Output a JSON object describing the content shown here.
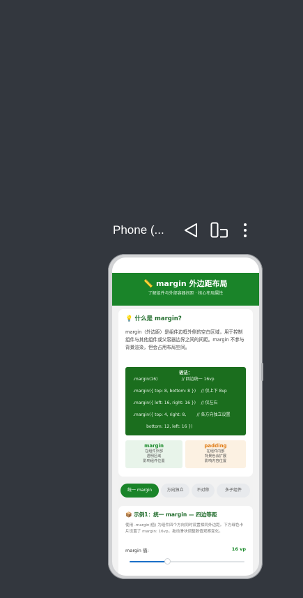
{
  "device": {
    "name": "Phone (...",
    "back_icon": "back-triangle-icon",
    "rotate_icon": "rotate-device-icon",
    "more_icon": "more-vertical-icon"
  },
  "header": {
    "title": "📏 margin 外边距布局",
    "subtitle": "了解组件与外部容器间距 · 核心布局属性"
  },
  "intro": {
    "heading": "💡 什么是 margin?",
    "description": "margin（外边距）是组件边框外侧的空白区域，用于控制组件与其他组件或父容器边界之间的间距。margin 不参与背景渲染，但会占用布局空间。",
    "code_title": "语法：",
    "code_lines": [
      ".margin(16)                  // 四边统一 16vp",
      ".margin({ top: 8, bottom: 8 })    // 仅上下 8vp",
      ".margin({ left: 16, right: 16 })    // 仅左右",
      ".margin({ top: 4, right: 8,        // 各方向独立设置",
      "          bottom: 12, left: 16 })"
    ],
    "compare": {
      "margin_title": "margin",
      "margin_desc": [
        "在组件外部",
        "透明区域",
        "影响组件位置"
      ],
      "padding_title": "padding",
      "padding_desc": [
        "在组件内部",
        "背景色会扩展",
        "影响内容位置"
      ]
    }
  },
  "tabs": [
    {
      "label": "统一 margin",
      "active": true
    },
    {
      "label": "方向独立",
      "active": false
    },
    {
      "label": "不对称",
      "active": false
    },
    {
      "label": "多子组件",
      "active": false
    }
  ],
  "example": {
    "heading": "📦 示例1：统一 margin — 四边等距",
    "description": "使用 .margin(值) 为组件四个方向同时设置相同外边距。下方绿色卡片设置了 margin: 16vp，拖动滑块调整数值观察变化。",
    "label": "margin 值:",
    "value": "16 vp",
    "slider_fraction": 0.33
  },
  "colors": {
    "accent": "#1a8429",
    "padding_accent": "#e07a12",
    "slider": "#1a6fc7"
  }
}
